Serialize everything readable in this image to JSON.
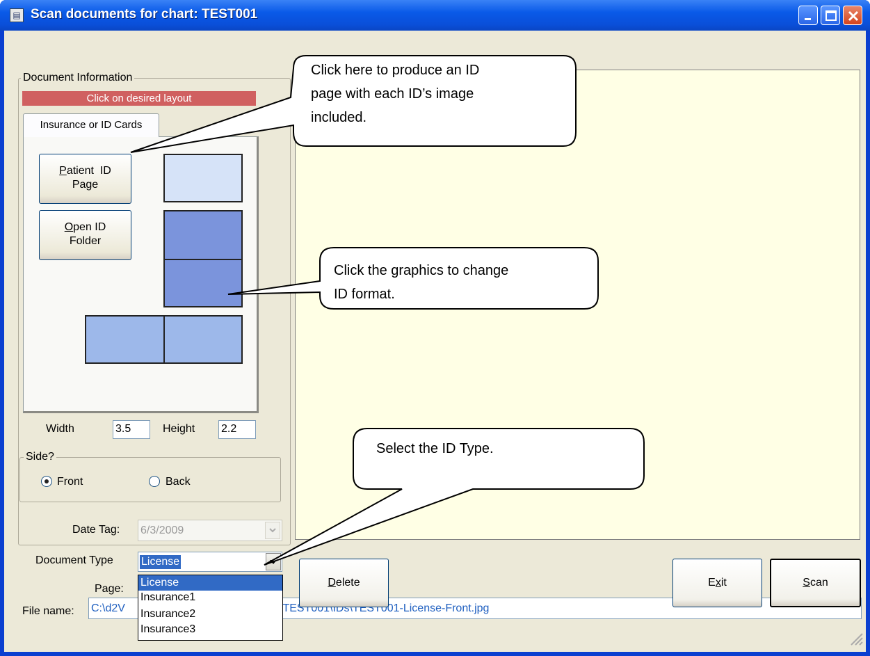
{
  "window": {
    "title": "Scan documents for chart: TEST001"
  },
  "doc_info": {
    "group_label": "Document Information",
    "layout_banner": "Click on desired layout",
    "tab_label": "Insurance or ID Cards",
    "patient_id_btn_line1": "Patient  ID",
    "patient_id_btn_line2": "Page",
    "open_id_btn_line1": "Open ID",
    "open_id_btn_line2": "Folder"
  },
  "dims": {
    "width_label": "Width",
    "width_value": "3.5",
    "height_label": "Height",
    "height_value": "2.2"
  },
  "side": {
    "group_label": "Side?",
    "front_label": "Front",
    "back_label": "Back",
    "selected": "Front"
  },
  "date_tag": {
    "label": "Date Tag:",
    "value": "6/3/2009"
  },
  "document_type": {
    "label": "Document Type",
    "value": "License",
    "options": [
      "License",
      "Insurance1",
      "Insurance2",
      "Insurance3"
    ]
  },
  "page": {
    "label": "Page:"
  },
  "file_name": {
    "label": "File name:",
    "value_left": "C:\\d2V",
    "value_right": "\\TEST001\\IDs\\TEST001-License-Front.jpg"
  },
  "buttons": {
    "delete": "Delete",
    "exit": "Exit",
    "scan": "Scan"
  },
  "callouts": {
    "id_page_l1": "Click here to produce an ID",
    "id_page_l2": "page with each ID’s image",
    "id_page_l3": "included.",
    "graphics_l1": "Click the graphics to change",
    "graphics_l2": "ID format.",
    "id_type": "Select the ID Type."
  },
  "colors": {
    "titlebar": "#0a5ae8",
    "banner": "#d06060",
    "preview_bg": "#ffffe5",
    "layout_light": "#d6e3f8",
    "layout_dark": "#7b94dc",
    "layout_mid": "#9db8ea",
    "selection": "#316ac5"
  }
}
